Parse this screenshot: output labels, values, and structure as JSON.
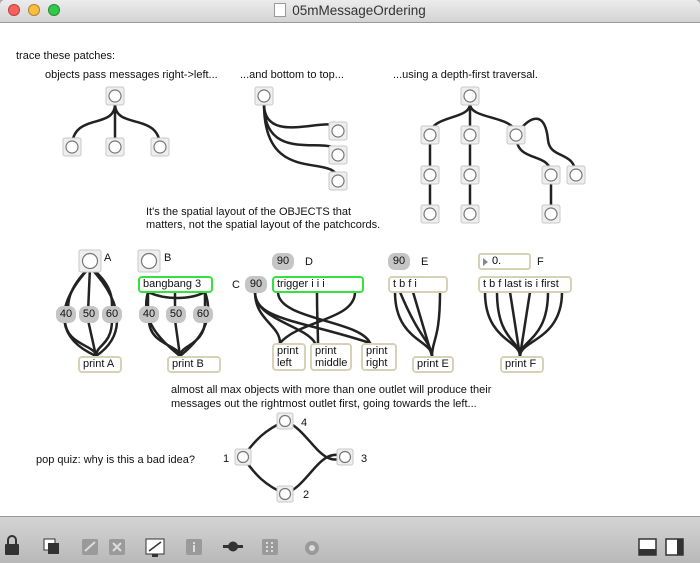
{
  "window": {
    "title": "05mMessageOrdering",
    "traffic_lights": {
      "close": "#fc605c",
      "minimize": "#fdbc40",
      "zoom": "#34c84a"
    }
  },
  "comments": {
    "trace": "trace these patches:",
    "rl": "objects pass messages right->left...",
    "bt": "...and bottom to top...",
    "df": "...using a depth-first traversal.",
    "spatial1": "It's the spatial layout of the OBJECTS that",
    "spatial2": "matters, not the spatial layout of the patchcords.",
    "almost1": "almost all max objects with more than one outlet will produce their",
    "almost2": "messages out the rightmost outlet first, going towards the left...",
    "quiz": "pop quiz: why is this a bad idea?"
  },
  "labels": {
    "A": "A",
    "B": "B",
    "C": "C",
    "D": "D",
    "E": "E",
    "F": "F",
    "q1": "1",
    "q2": "2",
    "q3": "3",
    "q4": "4"
  },
  "patch_A": {
    "n1": "40",
    "n2": "50",
    "n3": "60",
    "print": "print A"
  },
  "patch_B": {
    "bangbang": "bangbang 3",
    "n1": "40",
    "n2": "50",
    "n3": "60",
    "print": "print B"
  },
  "patch_C": {
    "num": "90"
  },
  "patch_D": {
    "num": "90",
    "trigger": "trigger i i i",
    "pl1": "print",
    "pl2": "left",
    "pm1": "print",
    "pm2": "middle",
    "pr1": "print",
    "pr2": "right"
  },
  "patch_E": {
    "num": "90",
    "tbfi": "t b f i",
    "print": "print E"
  },
  "patch_F": {
    "float": "0.",
    "tbf": "t b f last is i first",
    "print": "print F"
  },
  "accent": {
    "highlight_border": "#33e23a",
    "box_border": "#d6d2b8",
    "number_box": "#c5c5c5"
  },
  "toolbar": {
    "icons": [
      "lock-icon",
      "presentation-icon",
      "patchcord-icon",
      "delete-icon",
      "inspector-icon",
      "info-icon",
      "connect-icon",
      "grid-icon",
      "clue-icon",
      "split-view-icon",
      "sidebar-icon"
    ]
  }
}
